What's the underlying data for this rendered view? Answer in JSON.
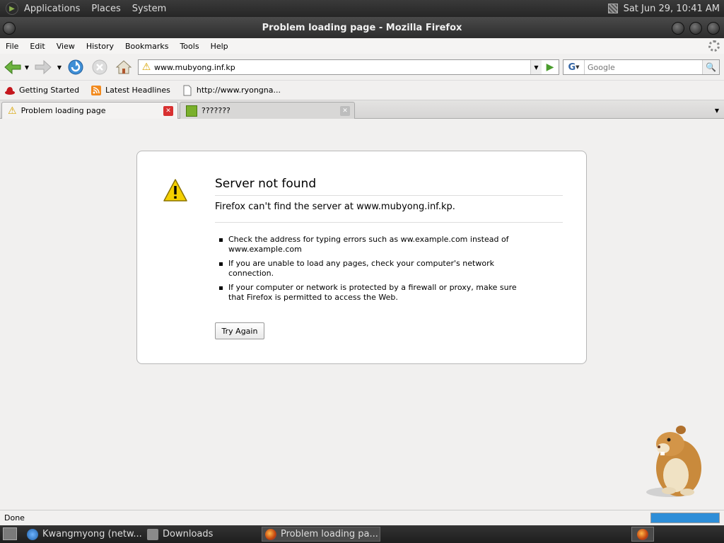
{
  "top_panel": {
    "menus": [
      "Applications",
      "Places",
      "System"
    ],
    "clock": "Sat Jun 29, 10:41 AM"
  },
  "window": {
    "title": "Problem loading page - Mozilla Firefox"
  },
  "menubar": {
    "items": [
      "File",
      "Edit",
      "View",
      "History",
      "Bookmarks",
      "Tools",
      "Help"
    ]
  },
  "navbar": {
    "url": "www.mubyong.inf.kp",
    "search_placeholder": "Google",
    "search_engine": "G"
  },
  "bookmarks": [
    {
      "label": "Getting Started",
      "icon": "redhat-icon"
    },
    {
      "label": "Latest Headlines",
      "icon": "rss-icon"
    },
    {
      "label": "http://www.ryongna...",
      "icon": "page-icon"
    }
  ],
  "tabs": [
    {
      "label": "Problem loading page",
      "icon": "warning-icon",
      "active": true
    },
    {
      "label": "???????",
      "icon": "site-icon",
      "active": false
    }
  ],
  "error": {
    "title": "Server not found",
    "description": "Firefox can't find the server at www.mubyong.inf.kp.",
    "tips": [
      "Check the address for typing errors such as ww.example.com instead of www.example.com",
      "If you are unable to load any pages, check your computer's network connection.",
      "If your computer or network is protected by a firewall or proxy, make sure that Firefox is permitted to access the Web."
    ],
    "button": "Try Again"
  },
  "status": {
    "text": "Done",
    "progress": 1.0
  },
  "taskbar": {
    "tasks": [
      {
        "label": "Kwangmyong (netw...",
        "icon": "browser-icon",
        "active": false
      },
      {
        "label": "Downloads",
        "icon": "folder-icon",
        "active": false
      },
      {
        "label": "Problem loading pa...",
        "icon": "firefox-icon",
        "active": true
      }
    ]
  },
  "colors": {
    "accent": "#2e8ed8",
    "panel": "#2a2a2a",
    "warning": "#f0c000"
  }
}
